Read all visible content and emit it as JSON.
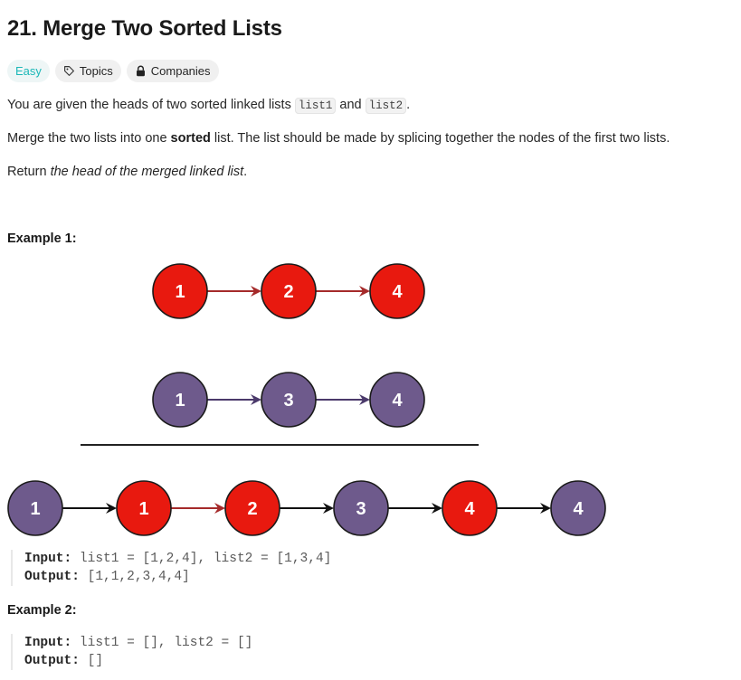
{
  "problem": {
    "title": "21. Merge Two Sorted Lists",
    "tags": {
      "difficulty": "Easy",
      "topics": "Topics",
      "companies": "Companies"
    },
    "desc1": {
      "pre": "You are given the heads of two sorted linked lists ",
      "code1": "list1",
      "mid": " and ",
      "code2": "list2",
      "post": "."
    },
    "desc2": {
      "pre": "Merge the two lists into one ",
      "bold": "sorted",
      "post": " list. The list should be made by splicing together the nodes of the first two lists."
    },
    "desc3": {
      "pre": "Return ",
      "italic": "the head of the merged linked list",
      "post": "."
    }
  },
  "examples": [
    {
      "title": "Example 1:",
      "input_label": "Input:",
      "input": "list1 = [1,2,4], list2 = [1,3,4]",
      "output_label": "Output:",
      "output": "[1,1,2,3,4,4]"
    },
    {
      "title": "Example 2:",
      "input_label": "Input:",
      "input": "list1 = [], list2 = []",
      "output_label": "Output:",
      "output": "[]"
    }
  ],
  "diagram": {
    "colors": {
      "list1": "#e8190f",
      "list2": "#6e5a8c",
      "arrow1": "#a52a2a",
      "arrow2": "#4b3a6b"
    },
    "list1": [
      "1",
      "2",
      "4"
    ],
    "list2": [
      "1",
      "3",
      "4"
    ],
    "merged": [
      {
        "v": "1",
        "src": "list2"
      },
      {
        "v": "1",
        "src": "list1"
      },
      {
        "v": "2",
        "src": "list1"
      },
      {
        "v": "3",
        "src": "list2"
      },
      {
        "v": "4",
        "src": "list1"
      },
      {
        "v": "4",
        "src": "list2"
      }
    ]
  }
}
